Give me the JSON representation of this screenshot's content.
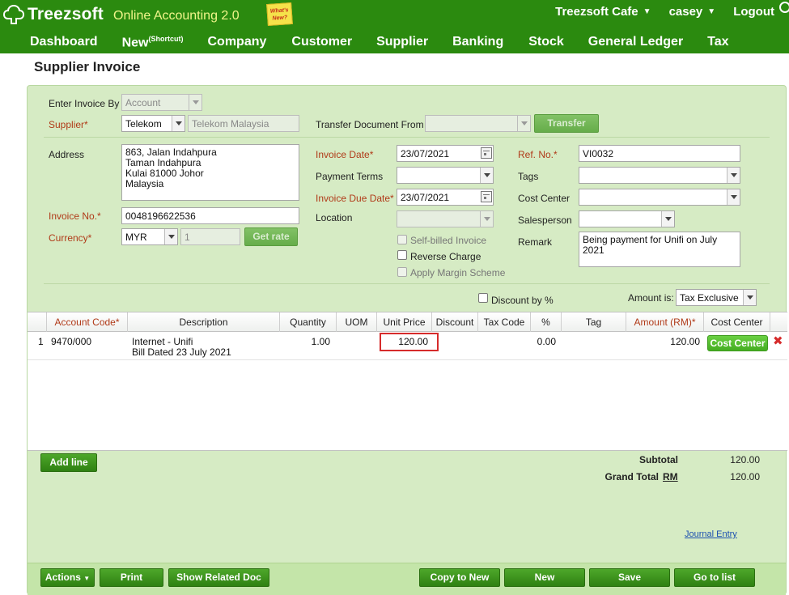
{
  "app": {
    "logo_text": "Treezsoft",
    "subtitle": "Online Accounting 2.0",
    "whats_new": "What's New?",
    "company_menu": "Treezsoft Cafe",
    "user_menu": "casey",
    "logout": "Logout"
  },
  "nav": {
    "dashboard": "Dashboard",
    "new": "New",
    "new_sup": "(Shortcut)",
    "company": "Company",
    "customer": "Customer",
    "supplier": "Supplier",
    "banking": "Banking",
    "stock": "Stock",
    "general_ledger": "General Ledger",
    "tax": "Tax"
  },
  "page": {
    "title": "Supplier Invoice"
  },
  "form": {
    "enter_invoice_by_label": "Enter Invoice By",
    "enter_invoice_by_value": "Account",
    "supplier_label": "Supplier*",
    "supplier_code": "Telekom",
    "supplier_name": "Telekom Malaysia",
    "transfer_from_label": "Transfer Document From",
    "transfer_from_value": "",
    "transfer_button": "Transfer",
    "address_label": "Address",
    "address_value": "863, Jalan Indahpura\nTaman Indahpura\nKulai 81000 Johor\nMalaysia",
    "invoice_no_label": "Invoice No.*",
    "invoice_no_value": "0048196622536",
    "currency_label": "Currency*",
    "currency_value": "MYR",
    "exchange_rate": "1",
    "get_rate_button": "Get rate",
    "invoice_date_label": "Invoice Date*",
    "invoice_date_value": "23/07/2021",
    "payment_terms_label": "Payment Terms",
    "payment_terms_value": "",
    "invoice_due_date_label": "Invoice Due Date*",
    "invoice_due_date_value": "23/07/2021",
    "location_label": "Location",
    "location_value": "",
    "self_billed_label": "Self-billed Invoice",
    "reverse_charge_label": "Reverse Charge",
    "apply_margin_label": "Apply Margin Scheme",
    "ref_no_label": "Ref. No.*",
    "ref_no_value": "VI0032",
    "tags_label": "Tags",
    "tags_value": "",
    "cost_center_label": "Cost Center",
    "cost_center_value": "",
    "salesperson_label": "Salesperson",
    "salesperson_value": "",
    "remark_label": "Remark",
    "remark_value": "Being payment for Unifi on July 2021",
    "discount_by_pct_label": "Discount by %",
    "amount_is_label": "Amount is:",
    "amount_is_value": "Tax Exclusive"
  },
  "grid": {
    "headers": {
      "account_code": "Account Code*",
      "description": "Description",
      "quantity": "Quantity",
      "uom": "UOM",
      "unit_price": "Unit Price",
      "discount": "Discount",
      "tax_code": "Tax Code",
      "pct": "%",
      "tag": "Tag",
      "amount": "Amount (RM)*",
      "cost_center": "Cost Center"
    },
    "rows": [
      {
        "num": "1",
        "account_code": "9470/000",
        "description_line1": "Internet - Unifi",
        "description_line2": "Bill Dated 23 July 2021",
        "quantity": "1.00",
        "uom": "",
        "unit_price": "120.00",
        "discount": "",
        "tax_code": "",
        "pct": "0.00",
        "tag": "",
        "amount": "120.00",
        "cost_center_button": "Cost Center"
      }
    ]
  },
  "totals": {
    "subtotal_label": "Subtotal",
    "subtotal_value": "120.00",
    "grand_total_label": "Grand Total",
    "currency": "RM",
    "grand_total_value": "120.00",
    "journal_entry_link": "Journal Entry"
  },
  "buttons": {
    "add_line": "Add line",
    "actions": "Actions",
    "print": "Print",
    "show_related_doc": "Show Related Doc",
    "copy_to_new": "Copy to New",
    "new": "New",
    "save": "Save",
    "go_to_list": "Go to list"
  },
  "colors": {
    "header_green": "#2b8a0f",
    "panel_green": "#d6ebc4",
    "required_red": "#b03a18",
    "highlight_red": "#d62b2b"
  }
}
